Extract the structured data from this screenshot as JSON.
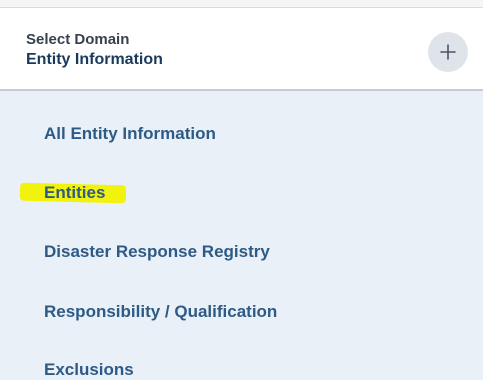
{
  "domain_selector": {
    "caption": "Select Domain",
    "title": "Entity Information",
    "expand_icon": "plus-icon"
  },
  "menu": {
    "items": [
      {
        "label": "All Entity Information",
        "highlighted": false
      },
      {
        "label": "Entities",
        "highlighted": true
      },
      {
        "label": "Disaster Response Registry",
        "highlighted": false
      },
      {
        "label": "Responsibility / Qualification",
        "highlighted": false
      },
      {
        "label": "Exclusions",
        "highlighted": false
      }
    ]
  },
  "colors": {
    "header_text": "#374151",
    "title_text": "#1a3a5c",
    "menu_text": "#2e5a86",
    "panel_background": "#e9f0f7",
    "button_background": "#dfe4ea",
    "highlight": "#f2f200"
  }
}
